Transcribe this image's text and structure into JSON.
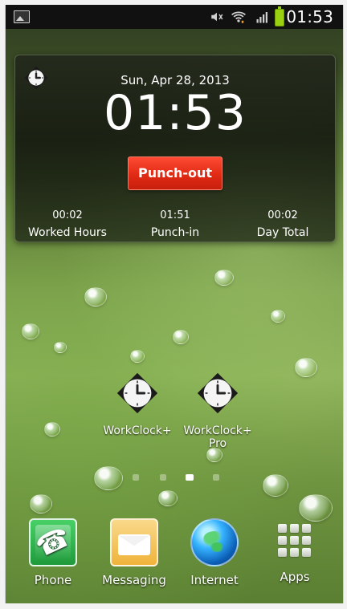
{
  "status_bar": {
    "time": "01:53",
    "icons": [
      "gallery-icon",
      "mute-icon",
      "wifi-icon",
      "signal-icon",
      "battery-icon"
    ],
    "colors": {
      "battery": "#9ad012"
    }
  },
  "widget": {
    "date": "Sun, Apr 28, 2013",
    "time": "01:53",
    "punch_button_label": "Punch-out",
    "stats": [
      {
        "value": "00:02",
        "label": "Worked Hours"
      },
      {
        "value": "01:51",
        "label": "Punch-in"
      },
      {
        "value": "00:02",
        "label": "Day Total"
      }
    ],
    "colors": {
      "punch_button": "#e12a14"
    }
  },
  "home_screen": {
    "apps": [
      {
        "label": "WorkClock+",
        "icon": "clock-icon"
      },
      {
        "label": "WorkClock+\nPro",
        "icon": "clock-icon"
      }
    ],
    "page_indicator": {
      "pages": 4,
      "active_index": 2
    }
  },
  "dock": {
    "items": [
      {
        "label": "Phone",
        "icon": "phone-icon"
      },
      {
        "label": "Messaging",
        "icon": "messaging-icon"
      },
      {
        "label": "Internet",
        "icon": "globe-icon"
      },
      {
        "label": "Apps",
        "icon": "apps-grid-icon"
      }
    ]
  }
}
